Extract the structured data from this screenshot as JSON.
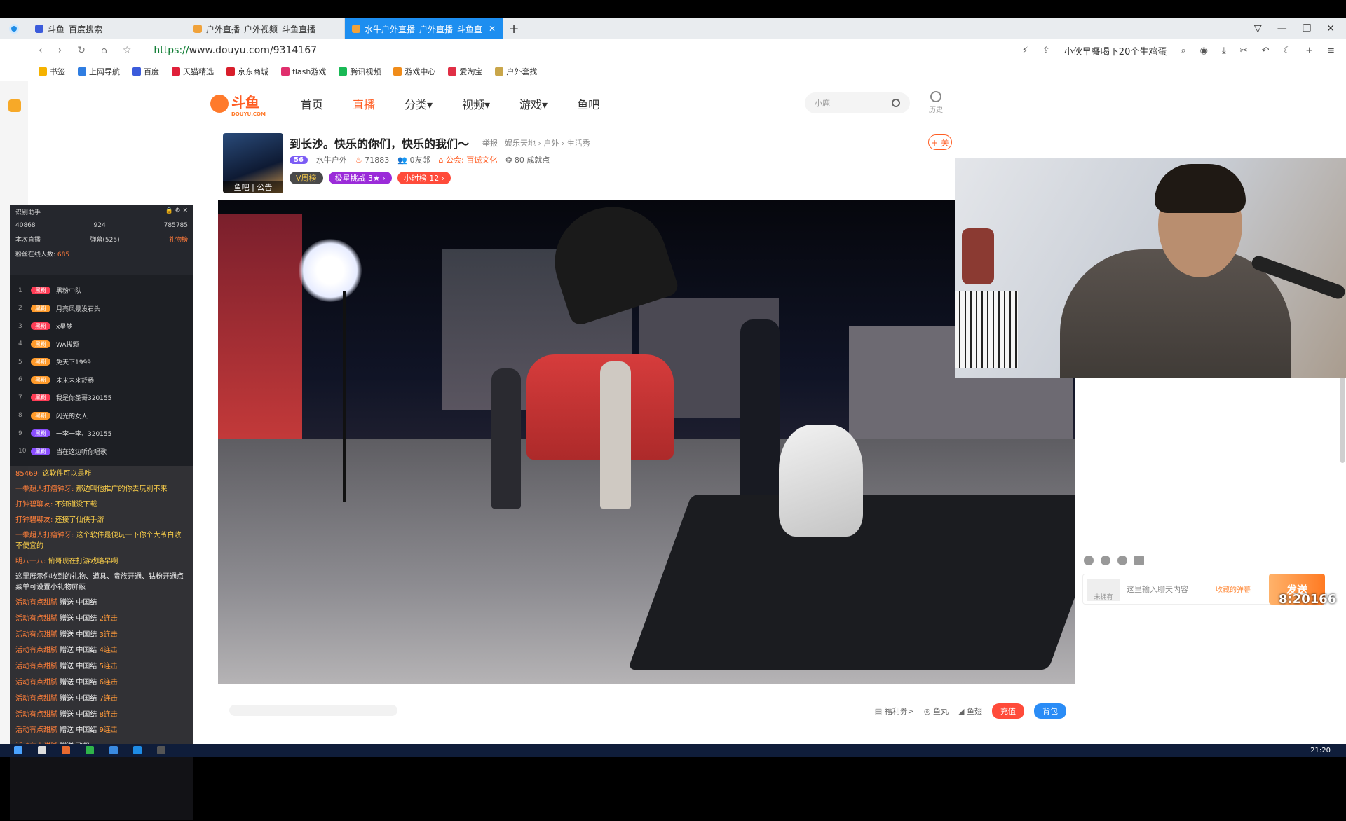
{
  "browser": {
    "tabs": [
      {
        "label": "斗鱼_百度搜索",
        "active": false
      },
      {
        "label": "户外直播_户外视频_斗鱼直播",
        "active": false
      },
      {
        "label": "水牛户外直播_户外直播_斗鱼直",
        "active": true
      }
    ],
    "url_scheme": "https://",
    "url_rest": "www.douyu.com/9314167",
    "search_suggestion": "小伙早餐喝下20个生鸡蛋",
    "bookmarks": [
      "书签",
      "上网导航",
      "百度",
      "天猫精选",
      "京东商城",
      "flash游戏",
      "腾讯视频",
      "游戏中心",
      "爱淘宝",
      "户外套找"
    ]
  },
  "douyu": {
    "logo_text": "斗鱼",
    "logo_sub": "DOUYU.COM",
    "nav": [
      {
        "label": "首页",
        "active": false
      },
      {
        "label": "直播",
        "active": true
      },
      {
        "label": "分类▾",
        "active": false
      },
      {
        "label": "视频▾",
        "active": false
      },
      {
        "label": "游戏▾",
        "active": false
      },
      {
        "label": "鱼吧",
        "active": false
      }
    ],
    "search_placeholder": "小鹿",
    "history_label": "历史"
  },
  "room": {
    "title": "到长沙。快乐的你们，快乐的我们～",
    "report": "举报",
    "category": "娱乐天地 › 户外 › 生活秀",
    "avatar_tabs": "鱼吧 | 公告",
    "level": "56",
    "anchor": "水牛户外",
    "heat": "71883",
    "friends": "0友邻",
    "guild_label": "公会:",
    "guild_value": "百诚文化",
    "achievements": "80 成就点",
    "badges": [
      "V周榜",
      "极星挑战 3★ ›",
      "小时榜 12 ›"
    ],
    "follow": "+ 关"
  },
  "left_overlay": {
    "header_lines": [
      [
        "识别助手",
        ""
      ],
      [
        "40868",
        "924",
        "785785"
      ],
      [
        "本次直播",
        "弹幕(525)",
        "礼物榜"
      ]
    ],
    "fans_label": "粉丝在线人数:",
    "fans_value": "685",
    "rank": [
      {
        "num": "1",
        "badge": "黑粉",
        "name": "黑粉中队",
        "style": "red"
      },
      {
        "num": "2",
        "badge": "黑粉",
        "name": "月亮风景没石头",
        "style": "orange"
      },
      {
        "num": "3",
        "badge": "黑粉",
        "name": "x星梦",
        "style": "red"
      },
      {
        "num": "4",
        "badge": "黑粉",
        "name": "WA拔颗",
        "style": "orange"
      },
      {
        "num": "5",
        "badge": "黑粉",
        "name": "免天下1999",
        "style": "orange"
      },
      {
        "num": "6",
        "badge": "黑粉",
        "name": "未来未来舒畅",
        "style": "orange"
      },
      {
        "num": "7",
        "badge": "黑粉",
        "name": "我是你圣哥320155",
        "style": "red"
      },
      {
        "num": "8",
        "badge": "黑粉",
        "name": "闪光的女人",
        "style": "orange"
      },
      {
        "num": "9",
        "badge": "黑粉",
        "name": "一李一李、320155",
        "style": "purple"
      },
      {
        "num": "10",
        "badge": "黑粉",
        "name": "当在这边听你唱歌",
        "style": "purple"
      }
    ],
    "chat": [
      {
        "name": "85469:",
        "text": "这软件可以是咋"
      },
      {
        "name": "一拳超人打瘤钟牙:",
        "text": "那边叫他推广的你去玩别不来"
      },
      {
        "name": "打钟碧聊友:",
        "text": "不知道没下载"
      },
      {
        "name": "打钟碧聊友:",
        "text": "还接了仙侠手游"
      },
      {
        "name": "一拳超人打瘤钟牙:",
        "text": "这个软件最便玩一下你个大爷白收不便宜的"
      },
      {
        "name": "明八一八:",
        "text": "俯哥现在打游戏略早啊"
      }
    ],
    "notice": "这里展示你收到的礼物、道具、贵族开通、钻粉开通点菜单可设置小礼物屏蔽",
    "gifts": [
      {
        "user": "活动有点甜腻",
        "act": "赠送",
        "gift": "中国结",
        "combo": ""
      },
      {
        "user": "活动有点甜腻",
        "act": "赠送",
        "gift": "中国结",
        "combo": "2连击"
      },
      {
        "user": "活动有点甜腻",
        "act": "赠送",
        "gift": "中国结",
        "combo": "3连击"
      },
      {
        "user": "活动有点甜腻",
        "act": "赠送",
        "gift": "中国结",
        "combo": "4连击"
      },
      {
        "user": "活动有点甜腻",
        "act": "赠送",
        "gift": "中国结",
        "combo": "5连击"
      },
      {
        "user": "活动有点甜腻",
        "act": "赠送",
        "gift": "中国结",
        "combo": "6连击"
      },
      {
        "user": "活动有点甜腻",
        "act": "赠送",
        "gift": "中国结",
        "combo": "7连击"
      },
      {
        "user": "活动有点甜腻",
        "act": "赠送",
        "gift": "中国结",
        "combo": "8连击"
      },
      {
        "user": "活动有点甜腻",
        "act": "赠送",
        "gift": "中国结",
        "combo": "9连击"
      },
      {
        "user": "活动有点甜腻",
        "act": "赠送",
        "gift": "飞机",
        "combo": ""
      }
    ]
  },
  "chat_panel": {
    "placeholder": "这里输入聊天内容",
    "level_hint": "未拥有",
    "send": "发送",
    "collect_hint": "收藏的弹幕",
    "timecode": "8:20166"
  },
  "video_bottom": {
    "welfare": "福利券>",
    "fishball": "鱼丸",
    "fishwing": "鱼翅",
    "recharge": "充值",
    "backpack": "背包"
  },
  "taskbar": {
    "clock": "21:20"
  }
}
